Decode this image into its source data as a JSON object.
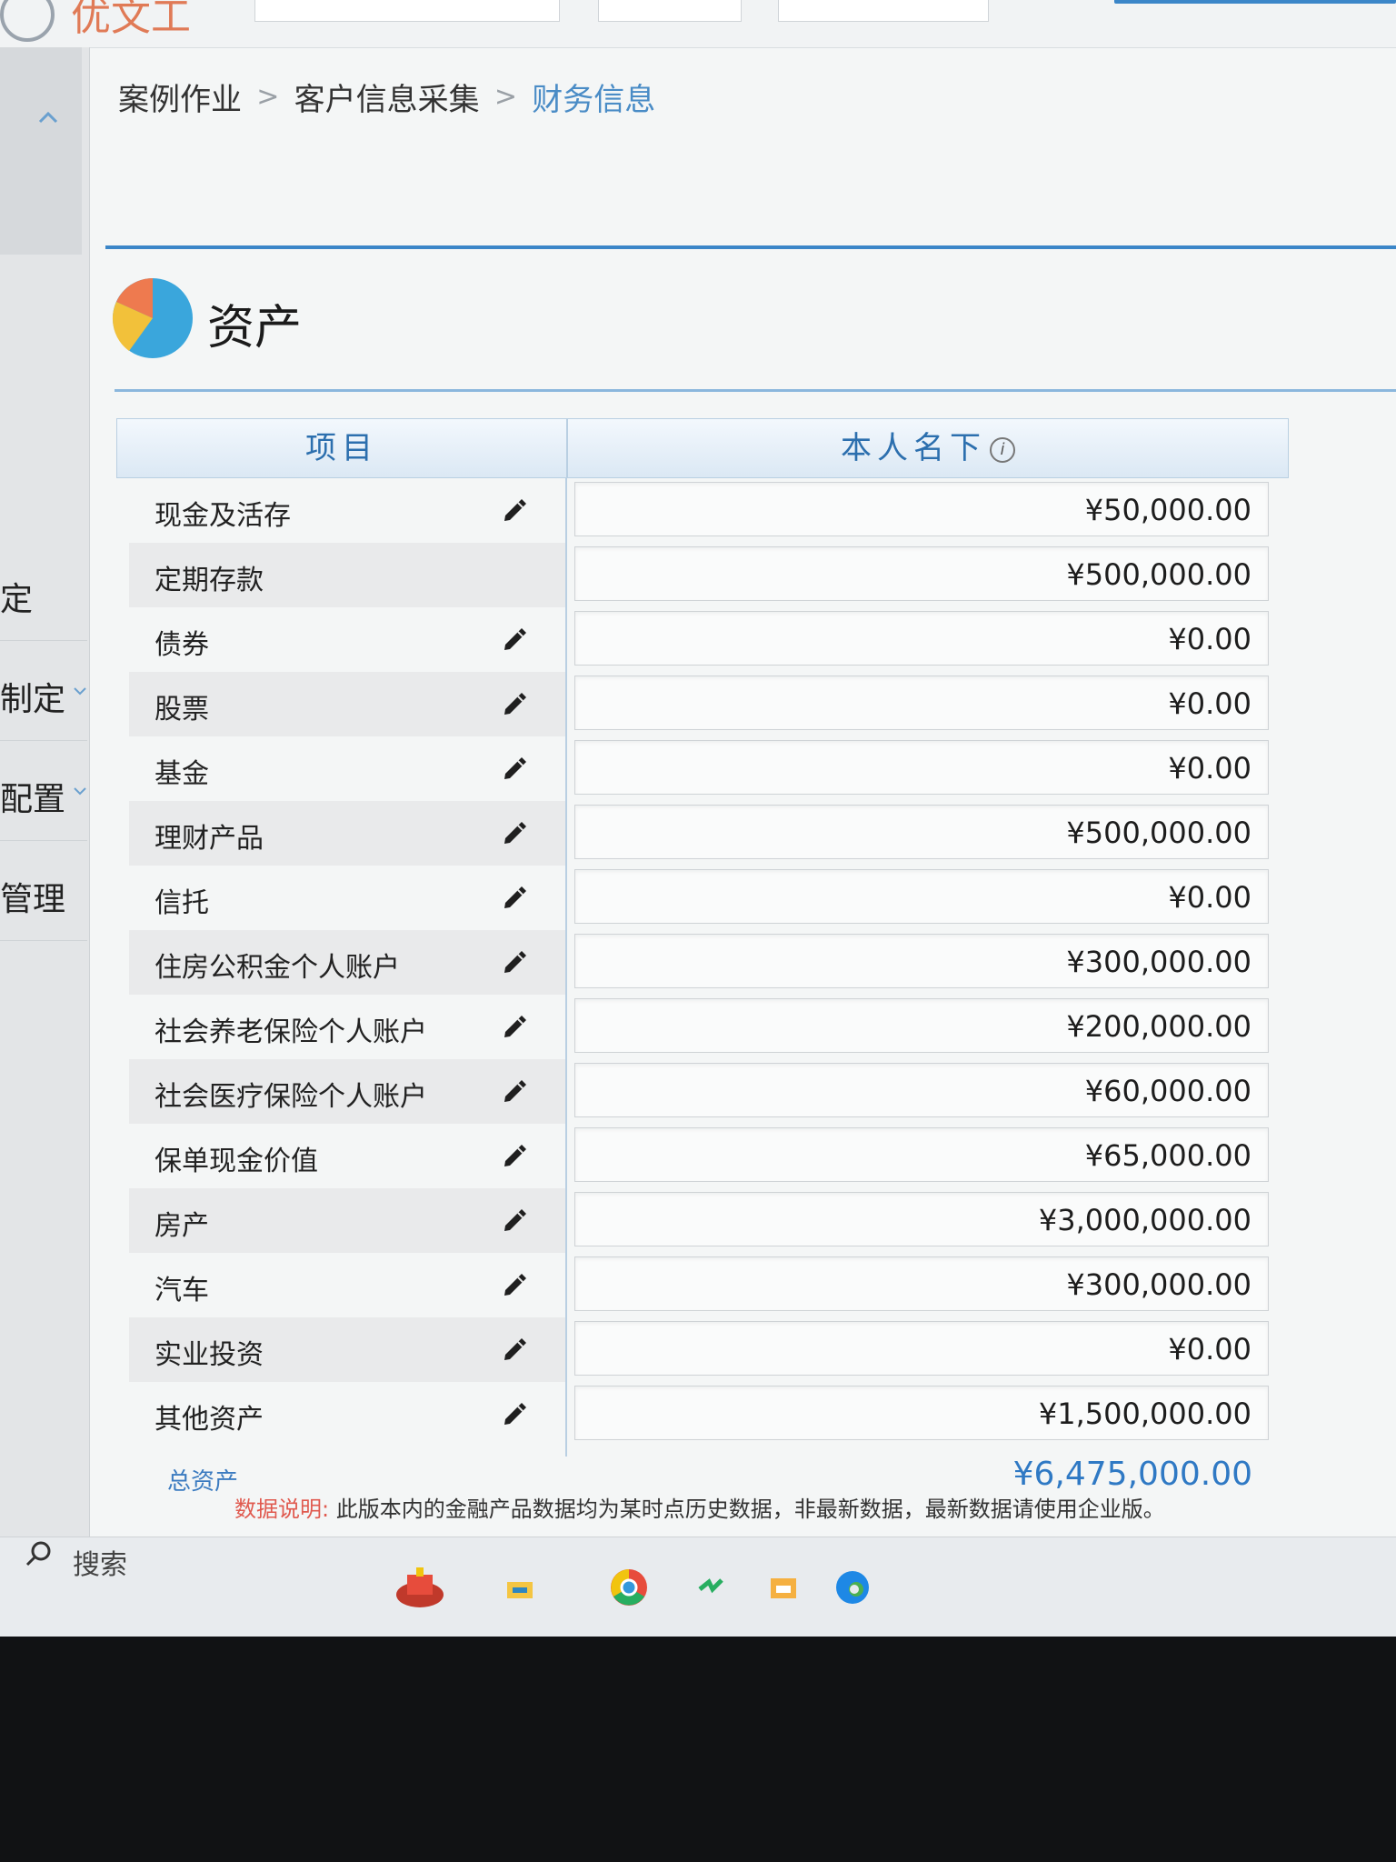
{
  "app": {
    "title": "优文工"
  },
  "breadcrumb": {
    "items": [
      "案例作业",
      "客户信息采集",
      "财务信息"
    ],
    "separator": ">"
  },
  "leftnav": {
    "items": [
      {
        "label": "定",
        "has_chevron": false
      },
      {
        "label": "制定",
        "has_chevron": true
      },
      {
        "label": "配置",
        "has_chevron": true
      },
      {
        "label": "管理",
        "has_chevron": false
      }
    ]
  },
  "section": {
    "title": "资产"
  },
  "table": {
    "header_item": "项目",
    "header_owner": "本人名下",
    "rows": [
      {
        "label": "现金及活存",
        "value": "¥50,000.00",
        "editable": true
      },
      {
        "label": "定期存款",
        "value": "¥500,000.00",
        "editable": false
      },
      {
        "label": "债券",
        "value": "¥0.00",
        "editable": true
      },
      {
        "label": "股票",
        "value": "¥0.00",
        "editable": true
      },
      {
        "label": "基金",
        "value": "¥0.00",
        "editable": true
      },
      {
        "label": "理财产品",
        "value": "¥500,000.00",
        "editable": true
      },
      {
        "label": "信托",
        "value": "¥0.00",
        "editable": true
      },
      {
        "label": "住房公积金个人账户",
        "value": "¥300,000.00",
        "editable": true
      },
      {
        "label": "社会养老保险个人账户",
        "value": "¥200,000.00",
        "editable": true
      },
      {
        "label": "社会医疗保险个人账户",
        "value": "¥60,000.00",
        "editable": true
      },
      {
        "label": "保单现金价值",
        "value": "¥65,000.00",
        "editable": true
      },
      {
        "label": "房产",
        "value": "¥3,000,000.00",
        "editable": true
      },
      {
        "label": "汽车",
        "value": "¥300,000.00",
        "editable": true
      },
      {
        "label": "实业投资",
        "value": "¥0.00",
        "editable": true
      },
      {
        "label": "其他资产",
        "value": "¥1,500,000.00",
        "editable": true
      }
    ],
    "total_label": "总资产",
    "total_value": "¥6,475,000.00"
  },
  "note": {
    "label": "数据说明:",
    "text": "此版本内的金融产品数据均为某时点历史数据，非最新数据，最新数据请使用企业版。"
  },
  "taskbar": {
    "search_label": "搜索",
    "icons": [
      "gift-icon",
      "file-explorer-icon",
      "chrome-icon",
      "app-icon",
      "folder-icon",
      "edge-icon"
    ]
  },
  "colors": {
    "accent": "#3b86c8",
    "header_text": "#2c6fae",
    "total": "#2f79c4",
    "note_label": "#e05a4f"
  }
}
